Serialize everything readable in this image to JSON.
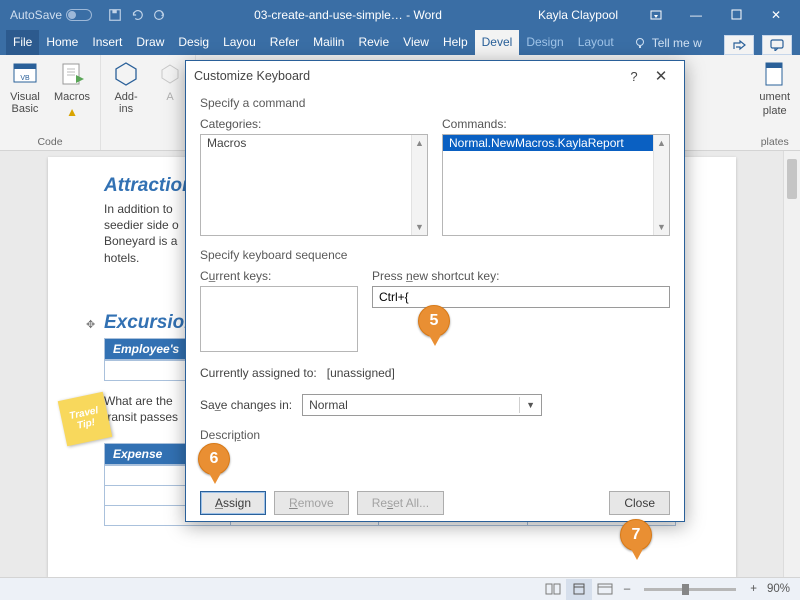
{
  "titlebar": {
    "autosave_label": "AutoSave",
    "doc_title": "03-create-and-use-simple… - Word",
    "user_name": "Kayla Claypool"
  },
  "ribbon_tabs": {
    "file": "File",
    "items": [
      "Home",
      "Insert",
      "Draw",
      "Desig",
      "Layou",
      "Refer",
      "Mailin",
      "Revie",
      "View",
      "Help",
      "Devel"
    ],
    "contextual": [
      "Design",
      "Layout"
    ],
    "tell_me": "Tell me w",
    "active_index": 10
  },
  "ribbon": {
    "vb_label": "Visual\nBasic",
    "macros_label": "Macros",
    "addins_label": "Add-\nins",
    "extra_label": "A",
    "group1_label": "Code",
    "far_group_label": "plates",
    "far_btn1": "ument",
    "far_btn2": "plate"
  },
  "document": {
    "h1": "Attraction",
    "p1": "In addition to",
    "p1b": "seedier side o",
    "p1c": "Boneyard is a",
    "p1d": "hotels.",
    "travel_tip": "Travel\nTip!",
    "h2": "Excursion",
    "bar1": "Employee's",
    "p2": "What are the",
    "p2b": "transit passes",
    "bar2": "Expense"
  },
  "dialog": {
    "title": "Customize Keyboard",
    "section1": "Specify a command",
    "categories_label": "Categories:",
    "commands_label": "Commands:",
    "category_item": "Macros",
    "command_item": "Normal.NewMacros.KaylaReport",
    "section2": "Specify keyboard sequence",
    "current_keys_label": "Current keys:",
    "press_new_label": "Press new shortcut key:",
    "press_new_value": "Ctrl+{",
    "assigned_label": "Currently assigned to:",
    "assigned_value": "[unassigned]",
    "save_in_label": "Save changes in:",
    "save_in_value": "Normal",
    "description_label": "Description",
    "btn_assign": "Assign",
    "btn_remove": "Remove",
    "btn_reset": "Reset All...",
    "btn_close": "Close"
  },
  "statusbar": {
    "zoom_value": "90%"
  },
  "pins": {
    "p5": "5",
    "p6": "6",
    "p7": "7"
  }
}
